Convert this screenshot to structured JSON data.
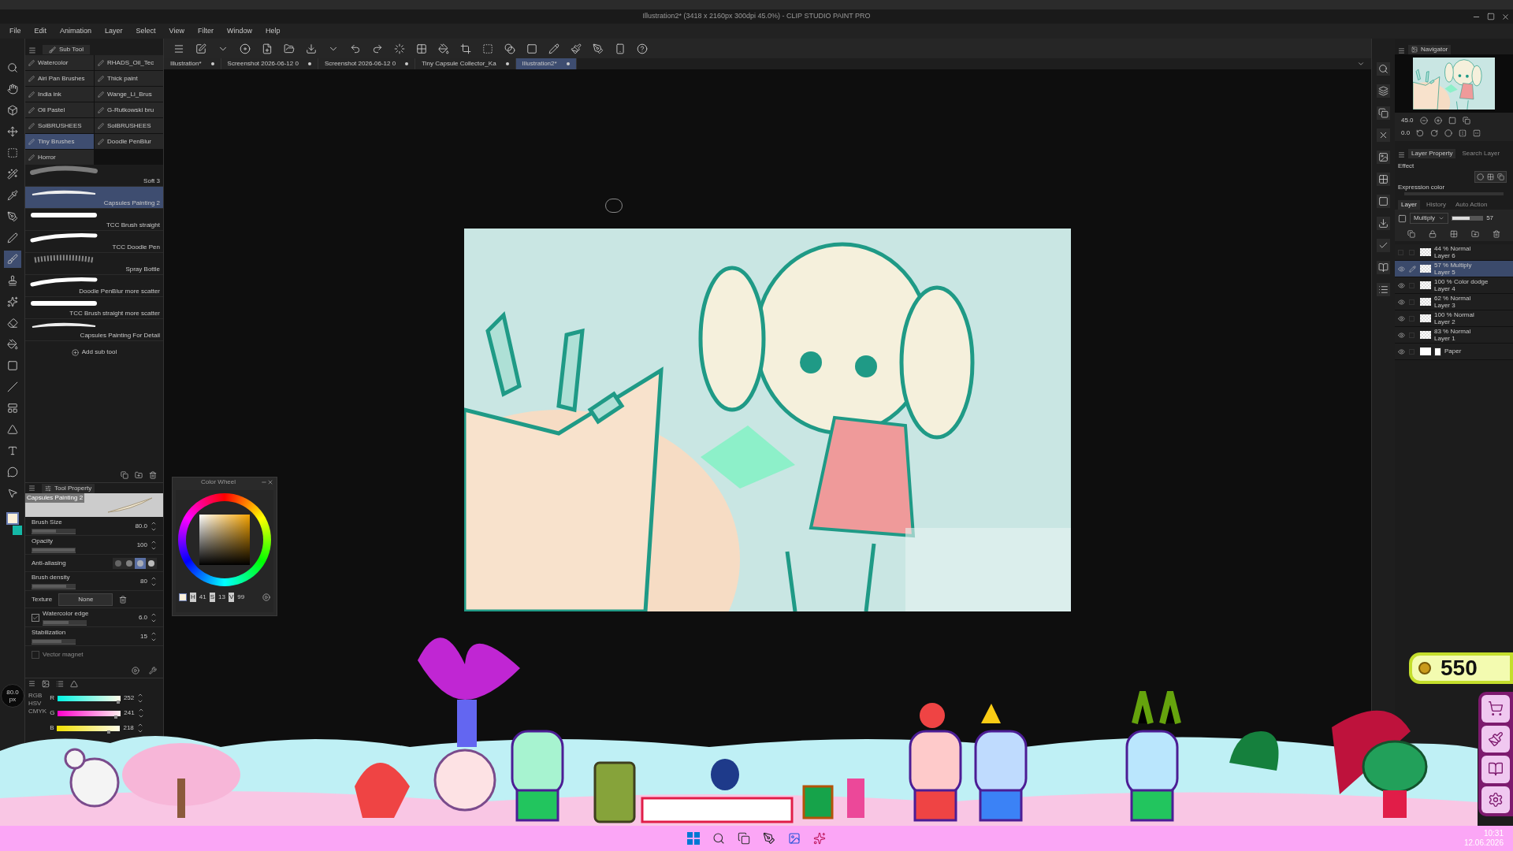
{
  "window": {
    "title": "Illustration2* (3418 x 2160px 300dpi 45.0%) - CLIP STUDIO PAINT PRO"
  },
  "menu": [
    "File",
    "Edit",
    "Animation",
    "Layer",
    "Select",
    "View",
    "Filter",
    "Window",
    "Help"
  ],
  "document_tabs": [
    {
      "label": "Illustration*",
      "selected": false
    },
    {
      "label": "Screenshot 2026-06-12 0",
      "selected": false
    },
    {
      "label": "Screenshot 2026-06-12 0",
      "selected": false
    },
    {
      "label": "Tiny Capsule Collector_Ka",
      "selected": false
    },
    {
      "label": "Illustration2*",
      "selected": true
    }
  ],
  "subtool": {
    "tab": "Sub Tool",
    "groups": [
      {
        "label": "Watercolor",
        "selected": false
      },
      {
        "label": "RHADS_Oil_Tec",
        "selected": false
      },
      {
        "label": "Airi Pan Brushes",
        "selected": false
      },
      {
        "label": "Thick paint",
        "selected": false
      },
      {
        "label": "India ink",
        "selected": false
      },
      {
        "label": "Wange_Li_Brus",
        "selected": false
      },
      {
        "label": "Oil Pastel",
        "selected": false
      },
      {
        "label": "G-Rutkowski bru",
        "selected": false
      },
      {
        "label": "SolBRUSHEES",
        "selected": false
      },
      {
        "label": "SolBRUSHEES",
        "selected": false
      },
      {
        "label": "Tiny Brushes",
        "selected": true
      },
      {
        "label": "Doodle PenBlur",
        "selected": false
      },
      {
        "label": "Horror",
        "selected": false
      }
    ],
    "brushes": [
      {
        "label": "Soft 3",
        "kind": "soft",
        "selected": false
      },
      {
        "label": "Capsules Painting 2",
        "kind": "taper",
        "selected": true
      },
      {
        "label": "TCC Brush straight",
        "kind": "straight",
        "selected": false
      },
      {
        "label": "TCC Doodle Pen",
        "kind": "solid",
        "selected": false
      },
      {
        "label": "Spray Bottle",
        "kind": "spray",
        "selected": false
      },
      {
        "label": "Doodle PenBlur more scatter",
        "kind": "solid",
        "selected": false
      },
      {
        "label": "TCC Brush straight more scatter",
        "kind": "straight",
        "selected": false
      },
      {
        "label": "Capsules Painting  For Detail",
        "kind": "taper",
        "selected": false
      }
    ],
    "add_label": "Add sub tool"
  },
  "tool_property": {
    "tab": "Tool Property",
    "preview_label": "Capsules Painting 2",
    "rows": [
      {
        "kind": "slider",
        "label": "Brush Size",
        "value": "80.0",
        "level": 0.55
      },
      {
        "kind": "slider",
        "label": "Opacity",
        "value": "100",
        "level": 1
      },
      {
        "kind": "antialias",
        "label": "Anti-aliasing",
        "options": [
          {
            "selected": false
          },
          {
            "selected": false
          },
          {
            "selected": true
          },
          {
            "selected": false
          }
        ]
      },
      {
        "kind": "slider",
        "label": "Brush density",
        "value": "80",
        "level": 0.8
      },
      {
        "kind": "texture",
        "label": "Texture",
        "value": "None"
      },
      {
        "kind": "checkslider",
        "label": "Watercolor edge",
        "checked": true,
        "value": "6.0",
        "level": 0.6
      },
      {
        "kind": "slider",
        "label": "Stabilization",
        "value": "15",
        "level": 0.68
      },
      {
        "kind": "check",
        "label": "Vector magnet",
        "checked": false
      }
    ]
  },
  "brush_size_readout": {
    "value": "80.0",
    "unit": "px"
  },
  "color_sliders": {
    "modes": [
      "RGB",
      "HSV",
      "CMYK"
    ],
    "channels": [
      {
        "name": "R",
        "value": "252",
        "level": 0.99
      },
      {
        "name": "G",
        "value": "241",
        "level": 0.95
      },
      {
        "name": "B",
        "value": "218",
        "level": 0.85
      }
    ]
  },
  "color_wheel": {
    "title": "Color Wheel",
    "readouts": [
      {
        "name": "H",
        "value": "41"
      },
      {
        "name": "S",
        "value": "13"
      },
      {
        "name": "V",
        "value": "99"
      }
    ]
  },
  "navigator": {
    "tab": "Navigator",
    "zoom": "45.0",
    "rotation": "0.0"
  },
  "layer_property": {
    "tab": "Layer Property",
    "search_tab": "Search Layer",
    "effect": "Effect",
    "expression_color": "Expression color"
  },
  "layer_panel": {
    "tabs": [
      {
        "label": "Layer",
        "selected": true
      },
      {
        "label": "History",
        "selected": false
      },
      {
        "label": "Auto Action",
        "selected": false
      }
    ],
    "blend_mode": "Multiply",
    "opacity": "57",
    "layers": [
      {
        "kind": "raster",
        "mode": "44 % Normal",
        "name": "Layer 6",
        "visible": false,
        "editing": false,
        "selected": false
      },
      {
        "kind": "raster",
        "mode": "57 % Multiply",
        "name": "Layer 5",
        "visible": true,
        "editing": true,
        "selected": true
      },
      {
        "kind": "raster",
        "mode": "100 % Color dodge",
        "name": "Layer 4",
        "visible": true,
        "editing": false,
        "selected": false
      },
      {
        "kind": "raster",
        "mode": "62 % Normal",
        "name": "Layer 3",
        "visible": true,
        "editing": false,
        "selected": false
      },
      {
        "kind": "raster",
        "mode": "100 % Normal",
        "name": "Layer 2",
        "visible": true,
        "editing": false,
        "selected": false
      },
      {
        "kind": "raster",
        "mode": "83 % Normal",
        "name": "Layer 1",
        "visible": true,
        "editing": false,
        "selected": false
      },
      {
        "kind": "paper",
        "name": "Paper",
        "visible": true,
        "editing": false,
        "selected": false
      }
    ]
  },
  "game": {
    "coins": "550"
  },
  "taskbar": {
    "time": "10:31",
    "date": "12.06.2026"
  }
}
